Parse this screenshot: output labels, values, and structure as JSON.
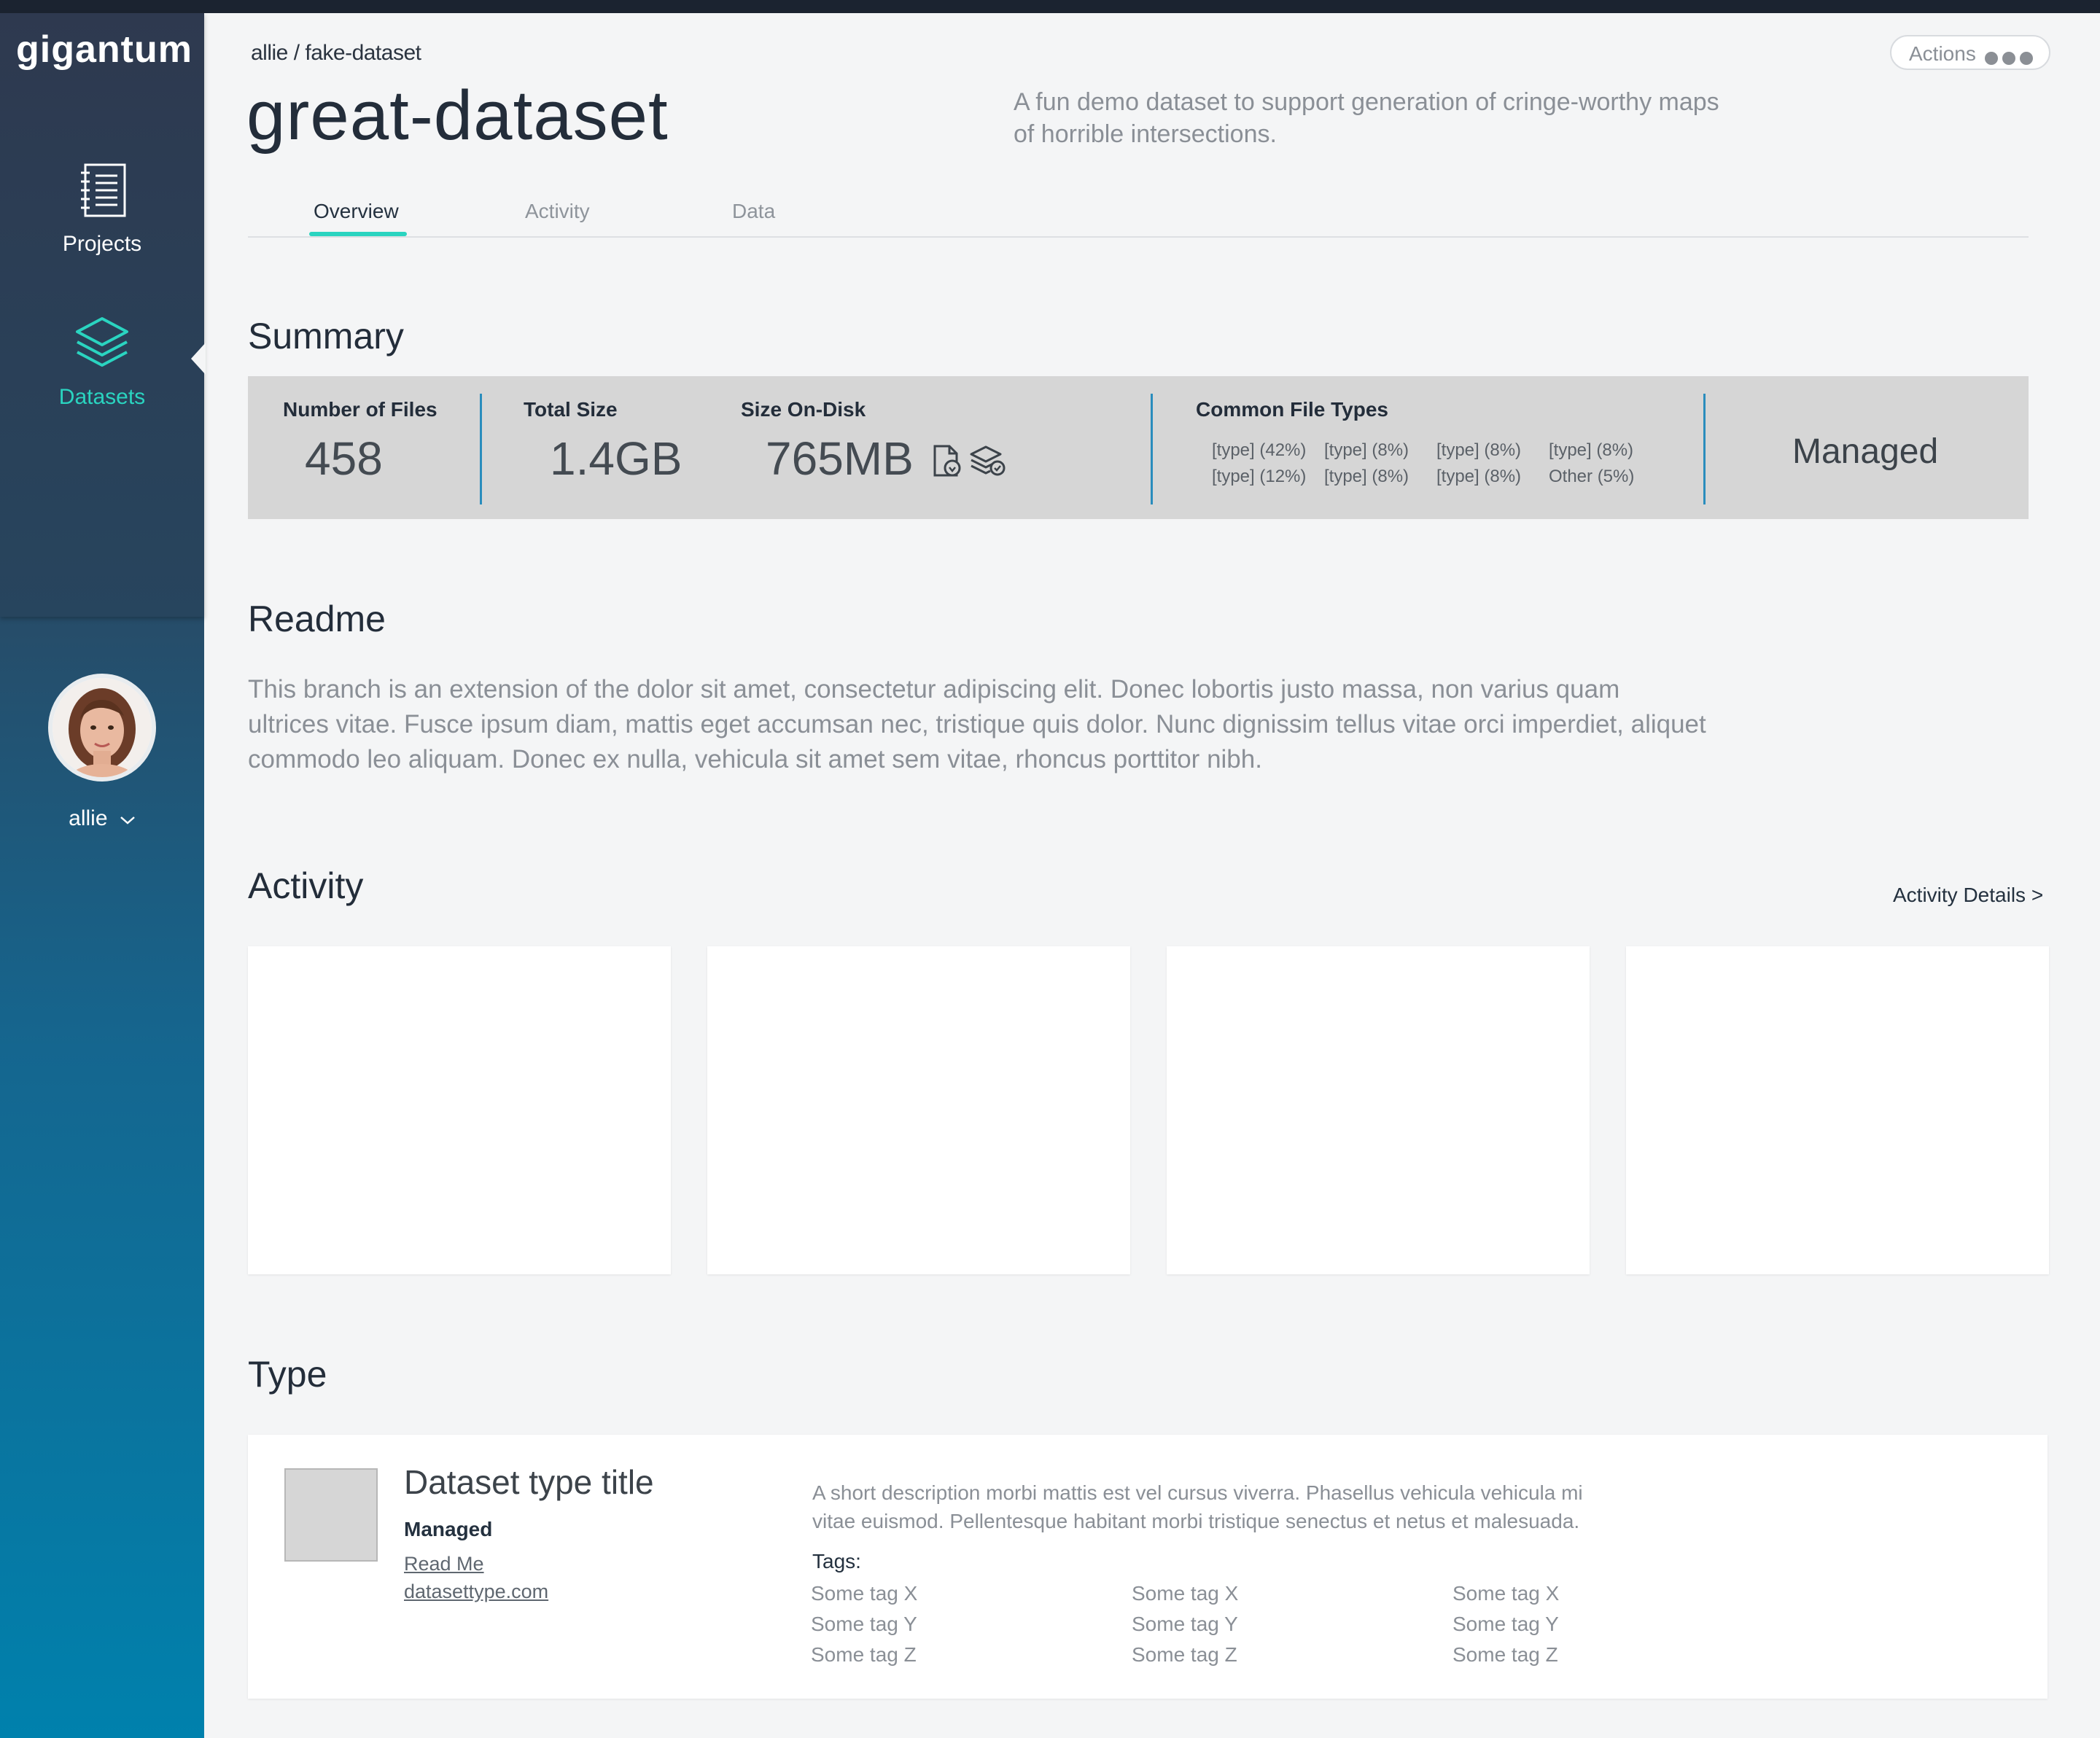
{
  "app": {
    "logo": "gigantum"
  },
  "sidebar": {
    "items": [
      {
        "label": "Projects",
        "icon": "notebook-icon"
      },
      {
        "label": "Datasets",
        "icon": "layers-icon",
        "active": true
      }
    ],
    "user": {
      "name": "allie"
    }
  },
  "header": {
    "breadcrumb": "allie / fake-dataset",
    "title": "great-dataset",
    "description": "A fun demo dataset to support generation of cringe-worthy maps of horrible intersections.",
    "actions_label": "Actions"
  },
  "tabs": [
    {
      "label": "Overview",
      "active": true
    },
    {
      "label": "Activity"
    },
    {
      "label": "Data"
    }
  ],
  "summary": {
    "title": "Summary",
    "files_label": "Number of Files",
    "files_value": "458",
    "total_size_label": "Total Size",
    "total_size_value": "1.4GB",
    "disk_label": "Size On-Disk",
    "disk_value": "765MB",
    "file_types_label": "Common File Types",
    "file_types": [
      "[type] (42%)",
      "[type] (8%)",
      "[type] (8%)",
      "[type] (8%)",
      "[type] (12%)",
      "[type] (8%)",
      "[type] (8%)",
      "Other (5%)"
    ],
    "managed": "Managed"
  },
  "readme": {
    "title": "Readme",
    "text": "This branch is an extension of the dolor sit amet, consectetur adipiscing elit. Donec lobortis justo massa, non varius quam ultrices vitae. Fusce ipsum diam, mattis eget accumsan nec, tristique quis dolor. Nunc dignissim tellus vitae orci imperdiet, aliquet commodo leo aliquam. Donec ex nulla, vehicula sit amet sem vitae, rhoncus porttitor nibh."
  },
  "activity": {
    "title": "Activity",
    "details_link": "Activity Details >"
  },
  "type_section": {
    "title": "Type",
    "card_title": "Dataset type title",
    "managed": "Managed",
    "readme_link": "Read Me",
    "website_link": "datasettype.com",
    "description": "A short description morbi mattis est vel cursus viverra. Phasellus vehicula vehicula mi vitae euismod. Pellentesque habitant morbi tristique senectus et netus et malesuada.",
    "tags_label": "Tags:",
    "tags": [
      "Some tag X",
      "Some tag Y",
      "Some tag Z",
      "Some tag X",
      "Some tag Y",
      "Some tag Z",
      "Some tag X",
      "Some tag Y",
      "Some tag Z"
    ]
  },
  "colors": {
    "accent": "#2ad4c0",
    "divider": "#2a8dbd",
    "sidebar_bottom": "#0081ad"
  }
}
